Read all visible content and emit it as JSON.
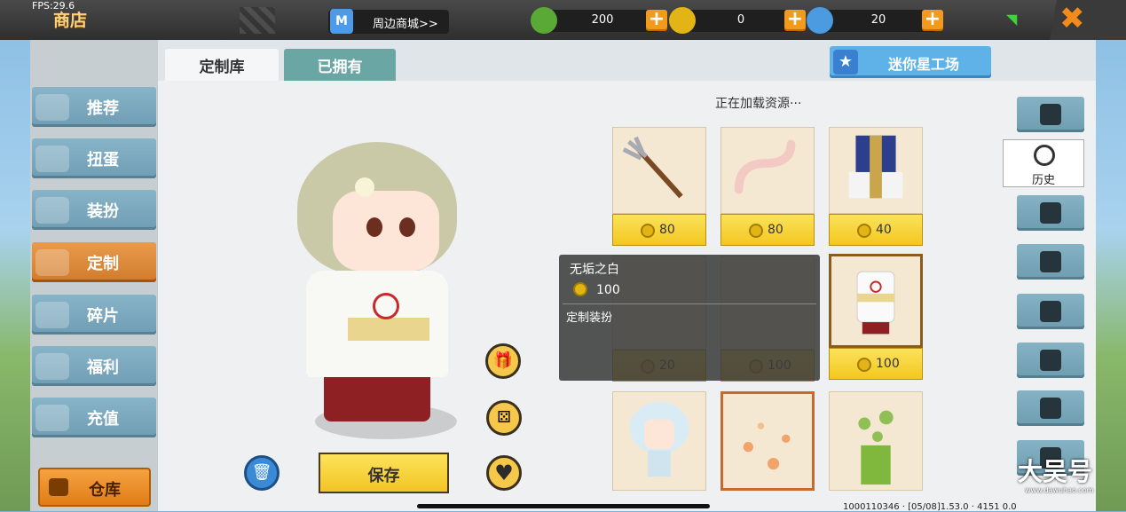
{
  "status": {
    "fps": "FPS:29.6"
  },
  "header": {
    "title": "商店",
    "shop_link": "周边商城>>",
    "currencies": [
      {
        "name": "mini-bean",
        "value": "200",
        "color": "#5aa836"
      },
      {
        "name": "mini-coin",
        "value": "0",
        "color": "#e3b416"
      },
      {
        "name": "star-coin",
        "value": "20",
        "color": "#4a9be0"
      }
    ],
    "close_icon": "✖"
  },
  "sidebar": {
    "items": [
      {
        "label": "推荐",
        "active": false
      },
      {
        "label": "扭蛋",
        "active": false
      },
      {
        "label": "装扮",
        "active": false
      },
      {
        "label": "定制",
        "active": true
      },
      {
        "label": "碎片",
        "active": false
      },
      {
        "label": "福利",
        "active": false
      },
      {
        "label": "充值",
        "active": false
      }
    ],
    "warehouse": "仓库"
  },
  "tabs": [
    {
      "label": "定制库",
      "active": true
    },
    {
      "label": "已拥有",
      "active": false
    }
  ],
  "studio_button": "迷你星工场",
  "loading_text": "正在加载资源···",
  "preview": {
    "save_label": "保存"
  },
  "items": [
    {
      "price": "80",
      "art": "trident"
    },
    {
      "price": "80",
      "art": "tail"
    },
    {
      "price": "40",
      "art": "outfit-blue"
    },
    {
      "price": "20",
      "art": "hidden"
    },
    {
      "price": "100",
      "art": "hidden"
    },
    {
      "price": "100",
      "art": "kimono-white",
      "selected": true
    },
    {
      "price": "",
      "art": "angel-girl"
    },
    {
      "price": "",
      "art": "flowers"
    },
    {
      "price": "",
      "art": "green-smoke"
    }
  ],
  "tooltip": {
    "name": "无垢之白",
    "price": "100",
    "type": "定制装扮"
  },
  "right_tools": {
    "history_label": "历史"
  },
  "watermark": {
    "text": "大吴号",
    "url": "www.dawuhao.com"
  },
  "debug": "1000110346 · [05/08]1.53.0 · 4151 0.0"
}
